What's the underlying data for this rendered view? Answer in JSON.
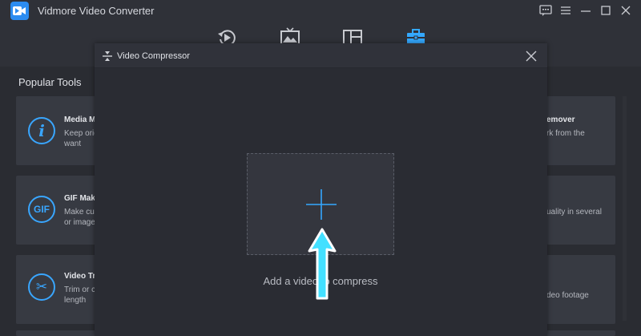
{
  "app": {
    "title": "Vidmore Video Converter"
  },
  "nav": {
    "items": [
      {
        "name": "converter",
        "icon": "convert-icon"
      },
      {
        "name": "mv",
        "icon": "image-icon"
      },
      {
        "name": "collage",
        "icon": "collage-icon"
      },
      {
        "name": "toolbox",
        "icon": "toolbox-icon",
        "active": true
      }
    ]
  },
  "window_controls": [
    "feedback-icon",
    "menu-icon",
    "minimize-icon",
    "maximize-icon",
    "close-icon"
  ],
  "section": {
    "title": "Popular Tools"
  },
  "cards_left": [
    {
      "title": "Media M",
      "desc1": "Keep origi",
      "desc2": "want",
      "icon": "info-icon",
      "glyph": "i"
    },
    {
      "title": "GIF Mak",
      "desc1": "Make cus",
      "desc2": "or image",
      "icon": "gif-icon",
      "glyph": "GIF"
    },
    {
      "title": "Video Tr",
      "desc1": "Trim or c",
      "desc2": "length",
      "icon": "scissors-icon",
      "glyph": "✂"
    }
  ],
  "cards_right": [
    {
      "title": "emover",
      "desc1": "rk from the",
      "desc2": ""
    },
    {
      "title": "",
      "desc1": "uality in several",
      "desc2": ""
    },
    {
      "title": "",
      "desc1": "deo footage",
      "desc2": ""
    }
  ],
  "dialog": {
    "title": "Video Compressor",
    "drop_label": "Add a video to compress"
  },
  "colors": {
    "accent": "#34a8ff",
    "arrow": "#43e0ff"
  }
}
